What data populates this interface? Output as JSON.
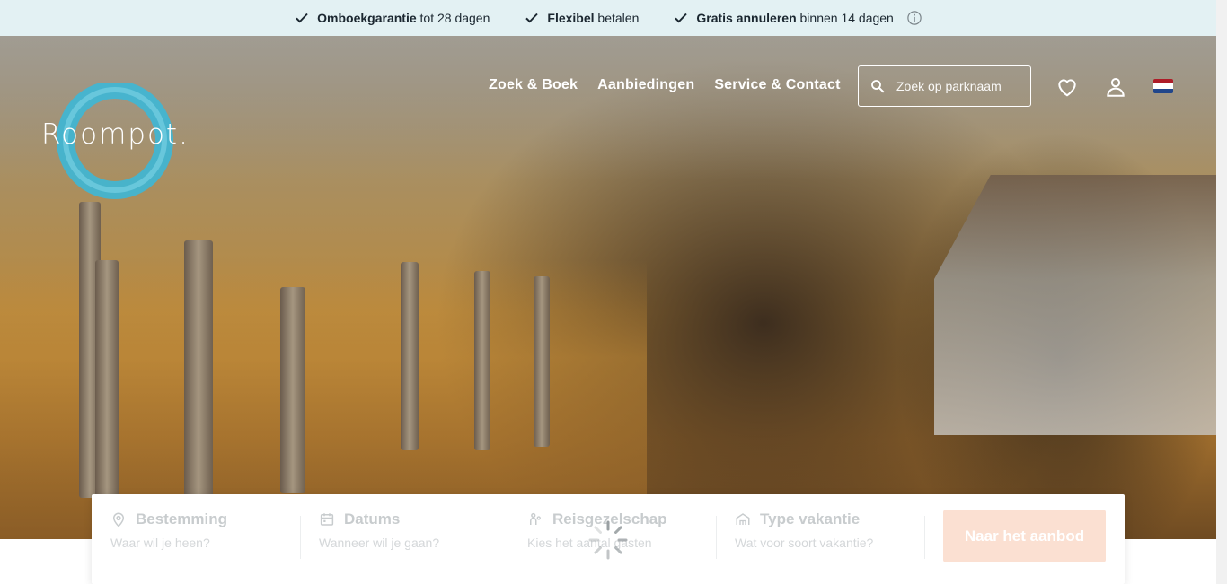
{
  "usp_bar": {
    "items": [
      {
        "bold": "Omboekgarantie",
        "rest": " tot 28 dagen"
      },
      {
        "bold": "Flexibel",
        "rest": " betalen"
      },
      {
        "bold": "Gratis annuleren",
        "rest": " binnen 14 dagen"
      }
    ]
  },
  "header": {
    "logo_text": "Roompot.",
    "nav": [
      "Zoek & Boek",
      "Aanbiedingen",
      "Service & Contact"
    ],
    "search_placeholder": "Zoek op parknaam"
  },
  "booking": {
    "fields": [
      {
        "label": "Bestemming",
        "sub": "Waar wil je heen?",
        "icon": "location-pin-icon"
      },
      {
        "label": "Datums",
        "sub": "Wanneer wil je gaan?",
        "icon": "calendar-icon"
      },
      {
        "label": "Reisgezelschap",
        "sub": "Kies het aantal gasten",
        "icon": "people-icon"
      },
      {
        "label": "Type vakantie",
        "sub": "Wat voor soort vakantie?",
        "icon": "house-icon"
      }
    ],
    "cta_label": "Naar het aanbod"
  },
  "colors": {
    "usp_background": "#e3f1f3",
    "logo_ring": "#3db7d6",
    "cta_disabled": "#fbe0d2",
    "flag": [
      "#ae1c28",
      "#ffffff",
      "#21468b"
    ]
  }
}
